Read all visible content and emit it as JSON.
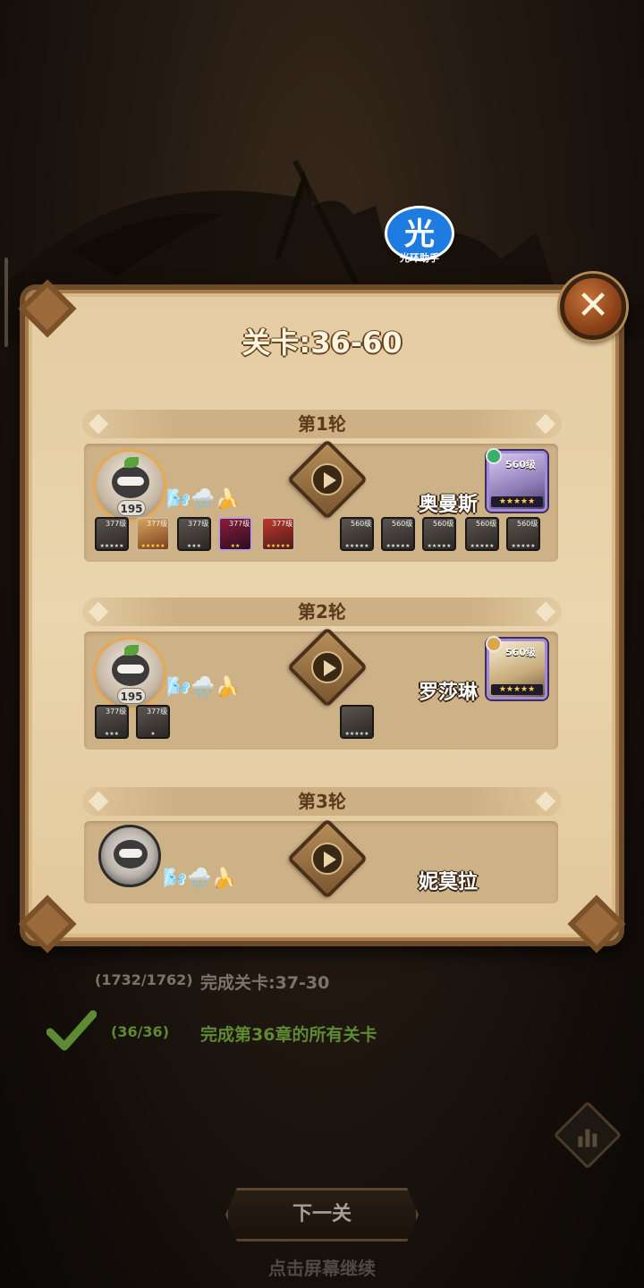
{
  "helper_badge": {
    "glyph": "光",
    "caption": "光环助手"
  },
  "panel": {
    "title": "关卡:36-60",
    "close_label": "✕"
  },
  "rounds": [
    {
      "header": "第1轮",
      "player_level": "195",
      "buffs": "🌬️🌧️🍌",
      "enemy_name": "奥曼斯",
      "enemy_level": "560级",
      "enemy_stars": "★★★★★",
      "player_team": [
        {
          "level": "377级",
          "stars": "★★★★★"
        },
        {
          "level": "377级",
          "stars": "★★★★★"
        },
        {
          "level": "377级",
          "stars": "★★★"
        },
        {
          "level": "377级",
          "stars": "★★"
        },
        {
          "level": "377级",
          "stars": "★★★★★"
        }
      ],
      "enemy_team": [
        {
          "level": "560级",
          "stars": "★★★★★"
        },
        {
          "level": "560级",
          "stars": "★★★★★"
        },
        {
          "level": "560级",
          "stars": "★★★★★"
        },
        {
          "level": "560级",
          "stars": "★★★★★"
        },
        {
          "level": "560级",
          "stars": "★★★★★"
        }
      ]
    },
    {
      "header": "第2轮",
      "player_level": "195",
      "buffs": "🌬️🌧️🍌",
      "enemy_name": "罗莎琳",
      "enemy_level": "560级",
      "enemy_stars": "★★★★★",
      "player_team": [
        {
          "level": "377级",
          "stars": "★★★"
        },
        {
          "level": "377级",
          "stars": "★"
        }
      ],
      "enemy_team": [
        {
          "level": "",
          "stars": "★★★★★"
        }
      ]
    },
    {
      "header": "第3轮",
      "buffs": "🌬️🌧️🍌",
      "enemy_name": "妮莫拉"
    }
  ],
  "quests": [
    {
      "count": "(1732/1762)",
      "text": "完成关卡:37-30",
      "done": false
    },
    {
      "count": "(36/36)",
      "text": "完成第36章的所有关卡",
      "done": true
    }
  ],
  "colors": {
    "quest_pending": "#7c7468",
    "quest_done": "#5d8a32"
  },
  "footer": {
    "next_button": "下一关",
    "tap_hint": "点击屏幕继续"
  }
}
